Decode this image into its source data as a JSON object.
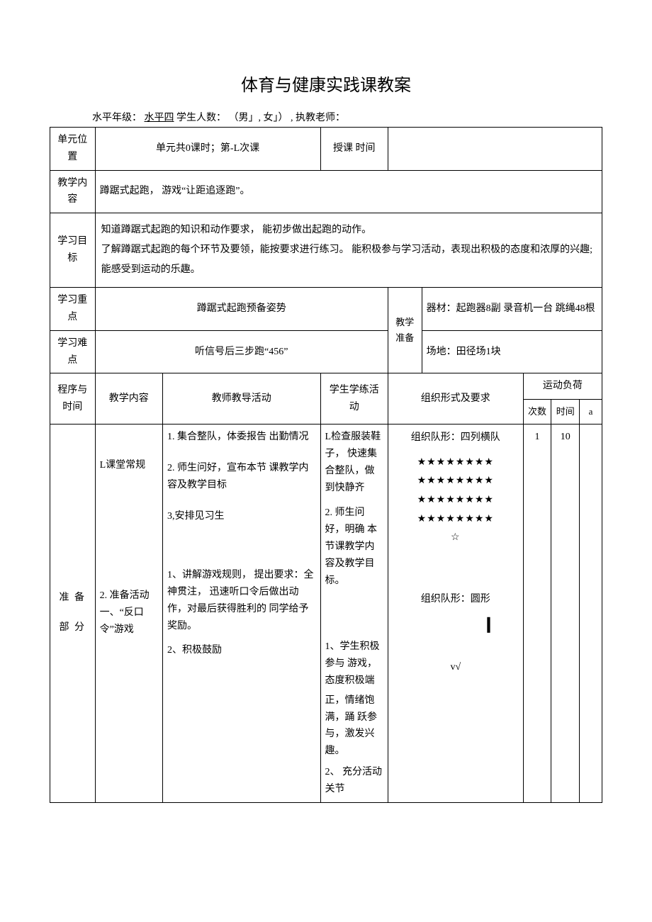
{
  "title": "体育与健康实践课教案",
  "meta": {
    "prefix": "水平年级：",
    "level": "水平四",
    "students_label": " 学生人数：",
    "students_value": "（男」, 女」）",
    "teacher_label": ", 执教老师：",
    "teacher_value": ""
  },
  "labels": {
    "unit_pos": "单元位置",
    "unit_pos_value": "单元共0课时；第-L次课",
    "class_time": "授课 时间",
    "class_time_value": "",
    "teach_content": "教学内容",
    "teach_content_value": "蹲踞式起跑，   游戏“让距追逐跑”。",
    "goals": "学习目标",
    "goals_value": "知道蹲踞式起跑的知识和动作要求，   能初步做出起跑的动作。\n了解蹲踞式起跑的每个环节及要领，能按要求进行练习。  能积极参与学习活动，表现出积极的态度和浓厚的兴趣;   能感受到运动的乐趣。",
    "focus": "学习重点",
    "focus_value": "蹲踞式起跑预备姿势",
    "difficulty": "学习难点",
    "difficulty_value": "听信号后三步跑“456”",
    "prep": "教学准备",
    "equipment": "器材：起跑器8副 录音机一台 跳绳48根",
    "venue": "场地：田径场1块",
    "col_prog": "程序与 时间",
    "col_content": "教学内容",
    "col_teacher": "教师教导活动",
    "col_student": "学生学练活动",
    "col_org": "组织形式及要求",
    "col_load": "运动负荷",
    "col_times": "次数",
    "col_minutes": "时间",
    "col_a": "a"
  },
  "row1": {
    "prog": "准\n\n备\n\n部\n\n分",
    "content1": "L课堂常规",
    "content2": "2. 准备活动一、“反口令”游戏",
    "teacher1": "1. 集合整队，体委报告 出勤情况",
    "teacher2": "2. 师生问好，宣布本节 课教学内容及教学目标",
    "teacher3": "3,安排见习生",
    "teacher4": "1、讲解游戏规则，  提出要求：全神贯注，  迅速听口令后做出动作，对最后获得胜利的 同学给予奖励。",
    "teacher5": "2、积极鼓励",
    "student1": "L检查服装鞋子，  快速集合整队，做 到快静齐",
    "student2": "2. 师生问好，明确 本节课教学内容及教学目标。",
    "student3": "1、学生积极参与 游戏，态度积极端",
    "student4": "正，情绪饱满，踊 跃参与，激发兴趣。",
    "student5": "2、 充分活动关节",
    "org1_title": "组织队形：四列横队",
    "org1_stars": "★★★★★★★★\n★★★★★★★★\n★★★★★★★★\n★★★★★★★★\n☆",
    "org2_title": "组织队形：圆形",
    "org2_mark": "v√",
    "times": "1",
    "minutes": "10",
    "a": ""
  }
}
